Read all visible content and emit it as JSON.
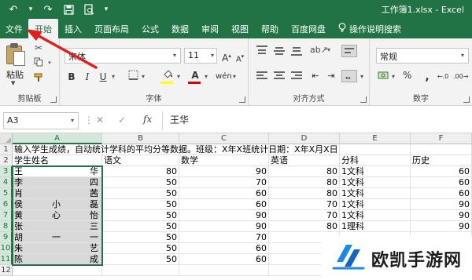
{
  "window": {
    "title": "工作簿1.xlsx  -  Excel",
    "accent_color": "#217346",
    "annotation_arrow_color": "#e02020"
  },
  "quick_access": {
    "undo_icon": "undo-icon",
    "redo_icon": "redo-icon",
    "save_icon": "save-icon",
    "print_preview_icon": "print-preview-icon"
  },
  "tabs": [
    {
      "label": "文件",
      "active": false
    },
    {
      "label": "开始",
      "active": true
    },
    {
      "label": "插入",
      "active": false
    },
    {
      "label": "页面布局",
      "active": false
    },
    {
      "label": "公式",
      "active": false
    },
    {
      "label": "数据",
      "active": false
    },
    {
      "label": "审阅",
      "active": false
    },
    {
      "label": "视图",
      "active": false
    },
    {
      "label": "帮助",
      "active": false
    },
    {
      "label": "百度网盘",
      "active": false
    },
    {
      "label": "操作说明搜索",
      "active": false
    }
  ],
  "ribbon": {
    "clipboard": {
      "label": "剪贴板",
      "paste_label": "粘贴"
    },
    "font": {
      "label": "字体",
      "font_name": "宋体",
      "font_size": "11",
      "bold": "B",
      "italic": "I",
      "underline": "U",
      "fill_color": "#ffff00",
      "font_color": "#e00000"
    },
    "alignment": {
      "label": "对齐方式"
    },
    "number": {
      "label": "数字",
      "format": "常规",
      "percent": "%"
    }
  },
  "formula_bar": {
    "name_box": "A3",
    "cancel": "✕",
    "enter": "✓",
    "fx": "fx",
    "value": "王华"
  },
  "sheet": {
    "columns": [
      "A",
      "B",
      "C",
      "D",
      "E",
      "F"
    ],
    "selected_column": "A",
    "rows": [
      "1",
      "2",
      "3",
      "4",
      "5",
      "6",
      "7",
      "8",
      "9",
      "10",
      "11",
      "12"
    ],
    "selected_rows": [
      "3",
      "4",
      "5",
      "6",
      "7",
      "8",
      "9",
      "10",
      "11"
    ],
    "row1": "输入学生成绩，自动统计学科的平均分等数据。班级：X年X班统计日期：X年X月X日",
    "headers": [
      "学生姓名",
      "语文",
      "数学",
      "英语",
      "分科",
      "历史"
    ],
    "data": [
      {
        "first": "王",
        "middle": "",
        "last": "华",
        "b": "80",
        "c": "90",
        "d": "80",
        "e": "1文科",
        "f": "60"
      },
      {
        "first": "李",
        "middle": "",
        "last": "四",
        "b": "50",
        "c": "70",
        "d": "80",
        "e": "1文科",
        "f": "60"
      },
      {
        "first": "肖",
        "middle": "",
        "last": "茜",
        "b": "50",
        "c": "60",
        "d": "80",
        "e": "1文科",
        "f": "60"
      },
      {
        "first": "侯",
        "middle": "小",
        "last": "磊",
        "b": "50",
        "c": "60",
        "d": "70",
        "e": "1文科",
        "f": "90"
      },
      {
        "first": "黄",
        "middle": "心",
        "last": "怡",
        "b": "50",
        "c": "90",
        "d": "70",
        "e": "1文科",
        "f": "90"
      },
      {
        "first": "张",
        "middle": "",
        "last": "三",
        "b": "50",
        "c": "90",
        "d": "80",
        "e": "1理科",
        "f": "90"
      },
      {
        "first": "胡",
        "middle": "一",
        "last": "一",
        "b": "50",
        "c": "70",
        "d": "",
        "e": "",
        "f": ""
      },
      {
        "first": "朱",
        "middle": "",
        "last": "艺",
        "b": "50",
        "c": "60",
        "d": "",
        "e": "",
        "f": ""
      },
      {
        "first": "陈",
        "middle": "",
        "last": "成",
        "b": "50",
        "c": "60",
        "d": "",
        "e": "",
        "f": ""
      },
      {
        "first": "",
        "middle": "",
        "last": "",
        "b": "",
        "c": "",
        "d": "",
        "e": "",
        "f": ""
      }
    ]
  },
  "watermark": {
    "text": "欧凯手游网"
  }
}
